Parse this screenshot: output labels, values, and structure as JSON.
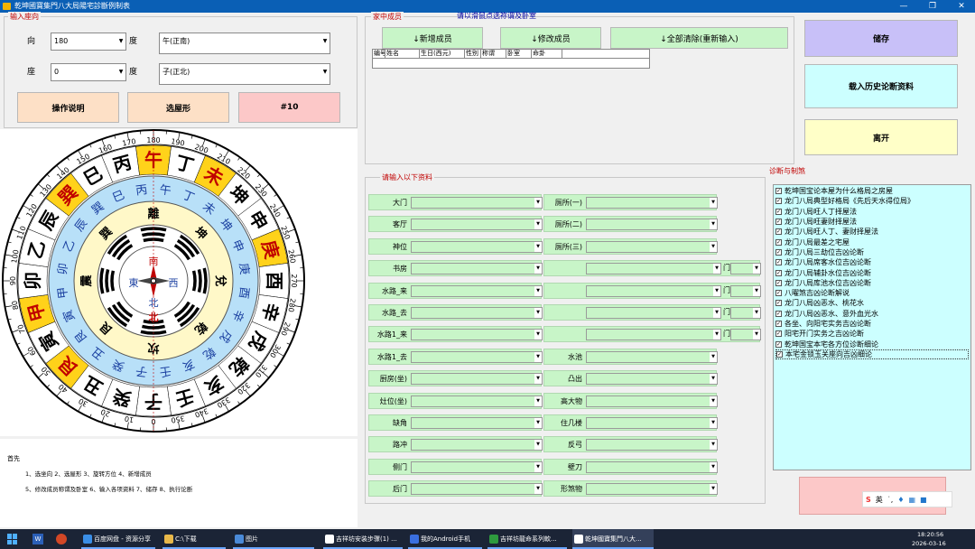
{
  "title": "乾坤國寶集門八大局陽宅診斷例制表",
  "input_group": {
    "title": "输入座向",
    "facing_label": "向",
    "facing_value": "180",
    "facing_unit": "度",
    "facing_dir": "午(正南)",
    "sitting_label": "座",
    "sitting_value": "0",
    "sitting_unit": "度",
    "sitting_dir": "子(正北)"
  },
  "buttons": {
    "help": "操作说明",
    "house": "选屋形",
    "north": "#10",
    "save": "储存",
    "load": "载入历史论断资料",
    "exit": "离开"
  },
  "family": {
    "title": "家中成员",
    "hint": "请以滑鼠点选祢谓及卧室",
    "add": "↓新增成员",
    "edit": "↓修改成员",
    "clear": "↓全部清除(重新输入)",
    "columns": [
      "编号",
      "姓名",
      "生日(西元)",
      "性别",
      "称谓",
      "卧室",
      "命卦"
    ]
  },
  "data_group": {
    "title": "请输入以下资料",
    "left": [
      "大门",
      "客厅",
      "神位",
      "书房",
      "水路_来",
      "水路_去",
      "水路1_来",
      "水路1_去",
      "厨房(坐)",
      "灶位(坐)",
      "缺角",
      "路冲",
      "侧门",
      "后门"
    ],
    "right": [
      "厕所(一)",
      "厕所(二)",
      "厕所(三)",
      "卧室(一)",
      "卧室(二)",
      "卧室(三)",
      "卧室(四)",
      "水池",
      "凸出",
      "高大物",
      "住几楼",
      "反弓",
      "壁刀",
      "形煞物"
    ],
    "room_suffix": "门"
  },
  "diag": {
    "title": "诊断与制煞",
    "items": [
      "乾坤国宝论本屋为什么格局之房屋",
      "龙门八局典型好格局《先后天水得位局》",
      "龙门八局旺人丁择屋法",
      "龙门八局旺妻财择屋法",
      "龙门八局旺人丁、妻财择屋法",
      "龙门八局最差之宅屋",
      "龙门八局三劫位吉凶论断",
      "龙门八局席客水位吉凶论断",
      "龙门八局辅卦水位吉凶论断",
      "龙门八局库池水位吉凶论断",
      "八曜煞吉凶论断解说",
      "龙门八局凶恶水、桃花水",
      "龙门八局凶恶水、意外血光水",
      "各坐、向阳宅实务吉凶论断",
      "阳宅开门实务之吉凶论断",
      "乾坤国宝本宅各方位诊断细论",
      "本宅金锁玉关座向吉凶细论"
    ]
  },
  "notes": {
    "heading": "首先",
    "line1": "1、选坐向 2、选屋形 3、旋转方位 4、新增成员",
    "line2": "5、修改成员称谓及卧室 6、输入各项资料 7、储存 8、执行论断"
  },
  "compass": {
    "outer_numbers": [
      "0",
      "10",
      "20",
      "30",
      "40",
      "50",
      "60",
      "70",
      "80",
      "90",
      "100",
      "110",
      "120",
      "130",
      "140",
      "150",
      "160",
      "170",
      "180",
      "190",
      "200",
      "210",
      "220",
      "230",
      "240",
      "250",
      "260",
      "270",
      "280",
      "290",
      "300",
      "310",
      "320",
      "330",
      "340",
      "350"
    ],
    "mountains": [
      "子",
      "癸",
      "丑",
      "艮",
      "寅",
      "甲",
      "卯",
      "乙",
      "辰",
      "巽",
      "巳",
      "丙",
      "午",
      "丁",
      "未",
      "坤",
      "申",
      "庚",
      "酉",
      "辛",
      "戌",
      "乾",
      "亥",
      "壬"
    ],
    "gua_ring": [
      "坎",
      "艮",
      "震",
      "巽",
      "離",
      "坤",
      "兌",
      "乾"
    ],
    "inner_labels": [
      "南",
      "北",
      "東",
      "西"
    ],
    "north_mark": "北"
  },
  "ime": {
    "mode": "英"
  },
  "taskbar": {
    "items": [
      "百度网盘 - 资源分享",
      "C:\\下载",
      "图片",
      "吉祥坊安装步骤(1) ...",
      "我的Android手机",
      "吉祥坊龍命系列軟...",
      "乾坤國寶集門八大..."
    ],
    "time": "18:20:56",
    "date": "2026-03-16"
  },
  "colors": {
    "accent_red": "#c00000",
    "field_green": "#c8f5c8",
    "list_cyan": "#ccffff"
  }
}
